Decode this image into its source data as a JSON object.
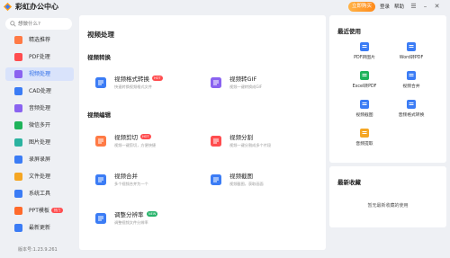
{
  "app": {
    "title": "彩虹办公中心",
    "buy_label": "立即购买",
    "login_label": "登录",
    "help_label": "帮助"
  },
  "search": {
    "placeholder": "想做什么?"
  },
  "sidebar": {
    "items": [
      {
        "label": "精选推荐",
        "icon": "star-icon",
        "color": "#ff7a45",
        "active": false
      },
      {
        "label": "PDF处理",
        "icon": "pdf-icon",
        "color": "#ff4d4f",
        "active": false
      },
      {
        "label": "视频处理",
        "icon": "video-icon",
        "color": "#8a63f0",
        "active": true
      },
      {
        "label": "CAD处理",
        "icon": "cad-icon",
        "color": "#3b7cf5",
        "active": false
      },
      {
        "label": "音频处理",
        "icon": "audio-icon",
        "color": "#8a63f0",
        "active": false
      },
      {
        "label": "微信多开",
        "icon": "wechat-icon",
        "color": "#1fb35a",
        "active": false
      },
      {
        "label": "图片处理",
        "icon": "image-icon",
        "color": "#2bb3a0",
        "active": false
      },
      {
        "label": "录屏录屏",
        "icon": "record-icon",
        "color": "#3b7cf5",
        "active": false
      },
      {
        "label": "文件处理",
        "icon": "file-icon",
        "color": "#f5a623",
        "active": false
      },
      {
        "label": "系统工具",
        "icon": "system-icon",
        "color": "#3b7cf5",
        "active": false
      },
      {
        "label": "PPT模板",
        "icon": "ppt-icon",
        "color": "#ff6a2b",
        "active": false,
        "tag": "热门"
      },
      {
        "label": "最新更新",
        "icon": "update-icon",
        "color": "#3b7cf5",
        "active": false
      }
    ],
    "version": "版本号:1.23.9.261"
  },
  "main": {
    "title": "视频处理",
    "sections": [
      {
        "title": "视频转换"
      },
      {
        "title": "视频编辑"
      }
    ],
    "tools": [
      {
        "name": "视频格式转换",
        "desc": "快速转换视频格式文件",
        "icon": "convert-icon",
        "color": "#3b7cf5",
        "badge": "HOT"
      },
      {
        "name": "视频转GIF",
        "desc": "视频一键转换成GIF",
        "icon": "gif-icon",
        "color": "#8a63f0",
        "badge": ""
      },
      {
        "name": "视频剪切",
        "desc": "视频一键剪切，方便快捷",
        "icon": "cut-icon",
        "color": "#ff7a45",
        "badge": "HOT"
      },
      {
        "name": "视频分割",
        "desc": "视频一键分割成多个片段",
        "icon": "split-icon",
        "color": "#ff4d4f",
        "badge": ""
      },
      {
        "name": "视频合并",
        "desc": "多个视频合并为一个",
        "icon": "merge-icon",
        "color": "#3b7cf5",
        "badge": ""
      },
      {
        "name": "视频截图",
        "desc": "视频截图，获取画面",
        "icon": "screenshot-icon",
        "color": "#3b7cf5",
        "badge": ""
      },
      {
        "name": "调整分辨率",
        "desc": "调整视频文件分辨率",
        "icon": "resolution-icon",
        "color": "#3b7cf5",
        "badge": "NEW"
      }
    ]
  },
  "recent": {
    "title": "最近使用",
    "items": [
      {
        "label": "PDF转图片",
        "icon": "pdf-image-icon",
        "color": "#3b7cf5"
      },
      {
        "label": "Word转PDF",
        "icon": "word-pdf-icon",
        "color": "#3b7cf5"
      },
      {
        "label": "Excel转PDF",
        "icon": "excel-pdf-icon",
        "color": "#1fb35a"
      },
      {
        "label": "视频合并",
        "icon": "merge-icon",
        "color": "#3b7cf5"
      },
      {
        "label": "视频截图",
        "icon": "screenshot-icon",
        "color": "#3b7cf5"
      },
      {
        "label": "音频格式转换",
        "icon": "audio-convert-icon",
        "color": "#3b7cf5"
      },
      {
        "label": "音频提取",
        "icon": "audio-extract-icon",
        "color": "#f5a623"
      }
    ]
  },
  "favorites": {
    "title": "最新收藏",
    "empty_text": "暂无最新收藏的使用"
  }
}
